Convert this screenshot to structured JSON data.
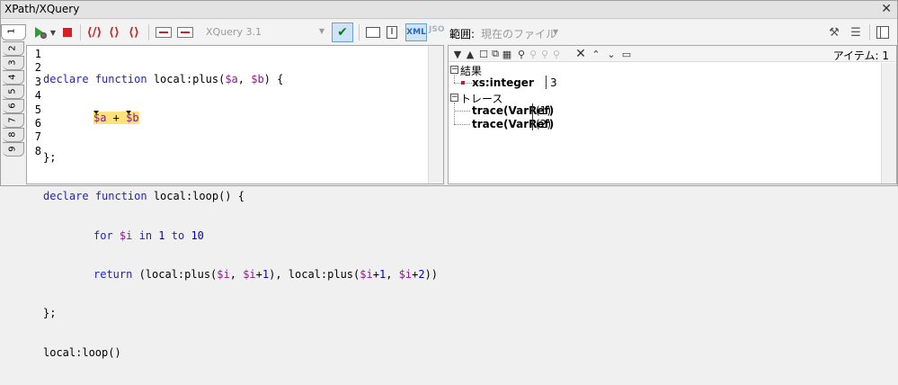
{
  "window": {
    "title": "XPath/XQuery",
    "close_glyph": "✕"
  },
  "tabs": [
    "1",
    "2",
    "3",
    "4",
    "5",
    "6",
    "7",
    "8",
    "9"
  ],
  "toolbar": {
    "xquery_version": "XQuery 3.1",
    "xml_label": "XML",
    "json_label": "JSO",
    "scope_label": "範囲:",
    "scope_value": "現在のファイル"
  },
  "editor": {
    "line_numbers": [
      "1",
      "2",
      "3",
      "4",
      "5",
      "6",
      "7",
      "8"
    ]
  },
  "results": {
    "items_label": "アイテム: 1",
    "result_group": "結果",
    "result_type": "xs:integer",
    "result_value": "3",
    "trace_group": "トレース",
    "trace_rows": [
      {
        "label": "trace(VarRef)",
        "value": "(1)"
      },
      {
        "label": "trace(VarRef)",
        "value": "(2)"
      }
    ]
  },
  "icons": {
    "run": "run-xquery-icon",
    "stop": "stop-icon",
    "check": "validate-check-icon",
    "accent_blue": "#1f1fc8",
    "highlight": "#ffe27a"
  }
}
